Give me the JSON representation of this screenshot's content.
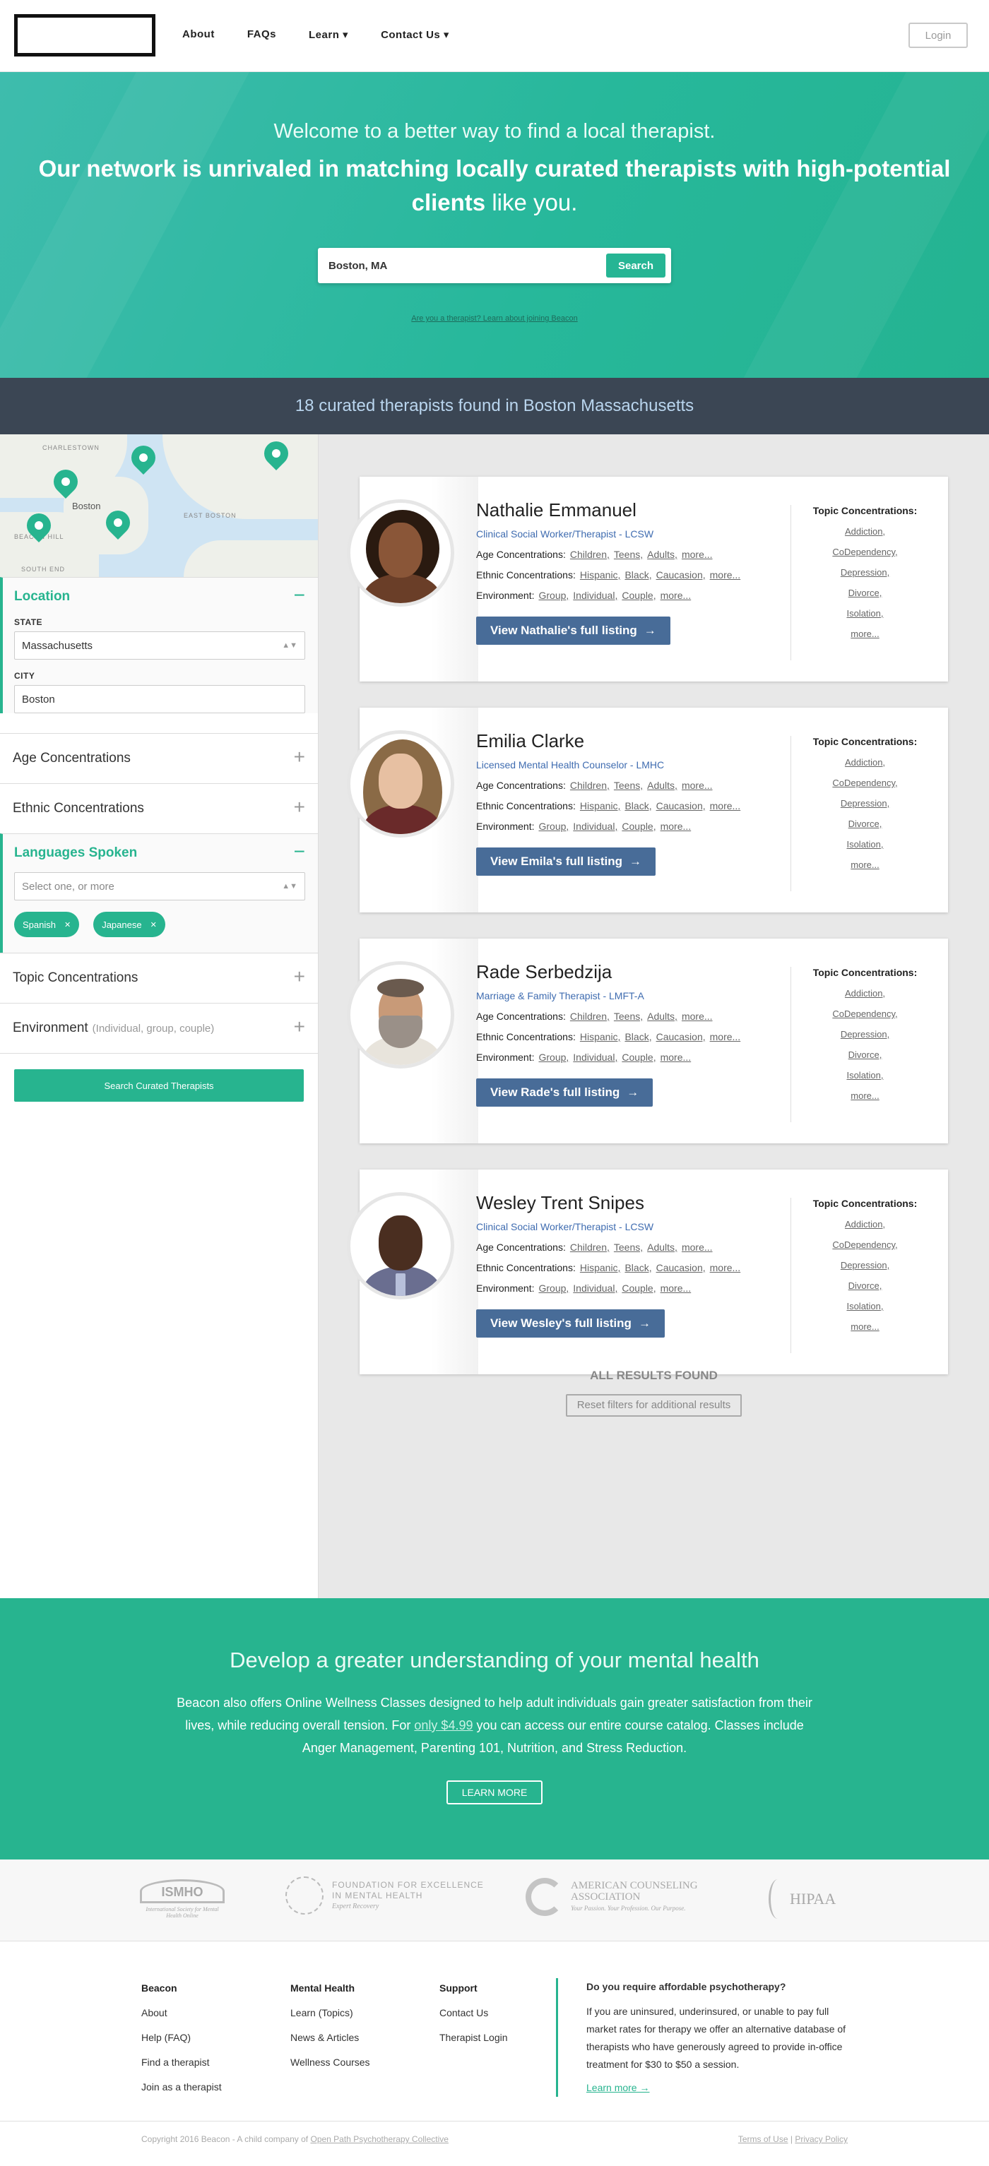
{
  "nav": {
    "links": [
      "About",
      "FAQs",
      "Learn ▾",
      "Contact Us ▾"
    ],
    "login": "Login"
  },
  "hero": {
    "welcome": "Welcome to a better way to find a local therapist.",
    "headline_main": "Our network is unrivaled in matching locally curated therapists with high-potential clients",
    "headline_tail": " like you.",
    "search_value": "Boston, MA",
    "search_button": "Search",
    "join_link": "Are you a therapist? Learn about joining Beacon"
  },
  "results_bar": "18 curated therapists found in Boston Massachusetts",
  "map": {
    "city": "Boston",
    "labels": [
      "CHARLESTOWN",
      "EAST BOSTON",
      "SOUTH END",
      "BEACON HILL"
    ]
  },
  "filters": {
    "location": {
      "title": "Location",
      "state_label": "STATE",
      "state_value": "Massachusetts",
      "city_label": "CITY",
      "city_value": "Boston"
    },
    "age": "Age Concentrations",
    "ethnic": "Ethnic Concentrations",
    "languages": {
      "title": "Languages Spoken",
      "placeholder": "Select one, or more",
      "tags": [
        "Spanish",
        "Japanese"
      ]
    },
    "topic": "Topic Concentrations",
    "environment": "Environment",
    "environment_hint": "(Individual, group, couple)",
    "search_button": "Search Curated Therapists"
  },
  "card_labels": {
    "age": "Age Concentrations:",
    "ethnic": "Ethnic Concentrations:",
    "environment": "Environment:",
    "age_values": [
      "Children,",
      "Teens,",
      "Adults,",
      "more..."
    ],
    "ethnic_values": [
      "Hispanic,",
      "Black,",
      "Caucasion,",
      "more..."
    ],
    "env_values": [
      "Group,",
      "Individual,",
      "Couple,",
      "more..."
    ],
    "topic_header": "Topic Concentrations:",
    "topic_values": [
      "Addiction,",
      "CoDependency,",
      "Depression,",
      "Divorce,",
      "Isolation,",
      "more..."
    ]
  },
  "therapists": [
    {
      "name": "Nathalie Emmanuel",
      "title": "Clinical Social Worker/Therapist - LCSW",
      "button": "View Nathalie's full listing"
    },
    {
      "name": "Emilia Clarke",
      "title": "Licensed Mental Health Counselor - LMHC",
      "button": "View Emila's full listing"
    },
    {
      "name": "Rade Serbedzija",
      "title": "Marriage & Family Therapist - LMFT-A",
      "button": "View Rade's full listing"
    },
    {
      "name": "Wesley Trent Snipes",
      "title": "Clinical Social Worker/Therapist - LCSW",
      "button": "View Wesley's full listing"
    }
  ],
  "all_results": {
    "title": "ALL RESULTS FOUND",
    "reset": "Reset filters for additional results"
  },
  "wellness": {
    "title": "Develop a greater understanding of your mental health",
    "p1": "Beacon also offers Online Wellness Classes designed to help adult individuals gain greater satisfaction from their lives, while reducing overall tension. For ",
    "price": "only $4.99",
    "p2": " you can access our entire course catalog. Classes include Anger Management, Parenting 101, Nutrition, and Stress Reduction.",
    "button": "LEARN MORE"
  },
  "partner_logos": {
    "ismho": "ISMHO",
    "ismho_sub": "International Society for Mental Health Online",
    "fem_line1": "FOUNDATION FOR EXCELLENCE",
    "fem_line2": "IN MENTAL HEALTH",
    "fem_sub": "Expert Recovery",
    "aca_line1": "AMERICAN COUNSELING",
    "aca_line2": "ASSOCIATION",
    "aca_sub": "Your Passion. Your Profession. Our Purpose.",
    "hipaa": "HIPAA"
  },
  "footer": {
    "col1": {
      "title": "Beacon",
      "items": [
        "About",
        "Help (FAQ)",
        "Find a therapist",
        "Join as a therapist"
      ]
    },
    "col2": {
      "title": "Mental Health",
      "items": [
        "Learn (Topics)",
        "News & Articles",
        "Wellness Courses"
      ]
    },
    "col3": {
      "title": "Support",
      "items": [
        "Contact Us",
        "Therapist Login"
      ]
    },
    "afford": {
      "title": "Do you require affordable psychotherapy?",
      "text": "If you are uninsured, underinsured, or unable to pay full market rates for therapy we offer an alternative database of therapists who have generously agreed to provide in-office treatment for $30 to $50 a session.",
      "link": "Learn more →"
    },
    "copyright": "Copyright 2016 Beacon - A child company of ",
    "company": "Open Path Psychotherapy Collective",
    "terms": "Terms of Use",
    "sep": "|",
    "privacy": "Privacy Policy"
  },
  "colors": {
    "teal": "#27b48f",
    "navy_bar": "#3b4654",
    "button_blue": "#486c98",
    "title_blue": "#3f6cb0"
  }
}
